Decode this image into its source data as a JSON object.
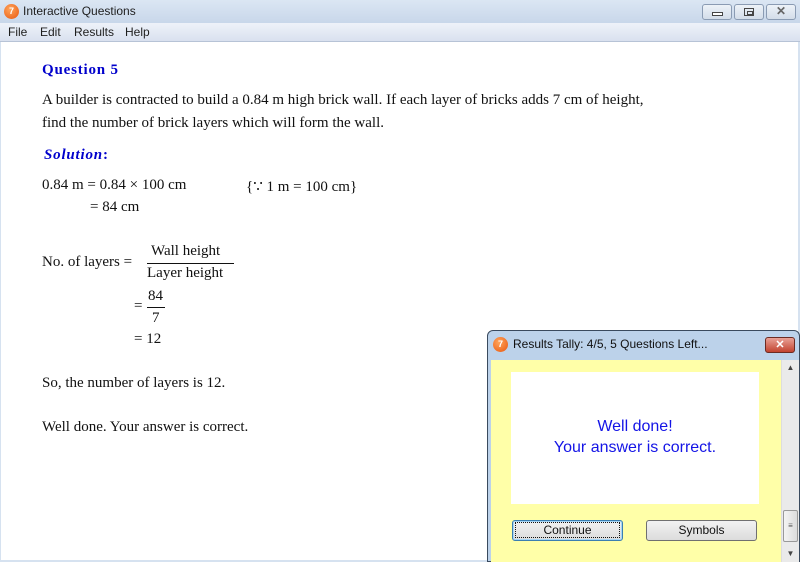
{
  "window": {
    "title": "Interactive Questions",
    "app_icon": "7",
    "controls": {
      "minimize": "minimize-icon",
      "maximize": "restore-icon",
      "close": "✕"
    }
  },
  "menu": [
    "File",
    "Edit",
    "Results",
    "Help"
  ],
  "question": {
    "title": "Question 5",
    "line1": "A builder is contracted to build a 0.84 m high brick wall.  If each layer of bricks adds 7 cm of height,",
    "line2": "find the number of brick layers which will form the wall."
  },
  "solution": {
    "title": "Solution",
    "colon": ":",
    "step1": "0.84 m = 0.84 × 100 cm",
    "step1_note": "{∵ 1 m = 100 cm}",
    "step2": "= 84 cm",
    "layers_label": "No. of layers =",
    "frac1_num": "Wall height",
    "frac1_den": "Layer height",
    "eq2": "=",
    "frac2_num": "84",
    "frac2_den": "7",
    "result": "= 12",
    "conclusion": "So, the number of layers is 12.",
    "feedback": "Well done.  Your answer is correct."
  },
  "dialog": {
    "title": "Results Tally:  4/5, 5 Questions Left...",
    "icon": "7",
    "close": "✕",
    "message_line1": "Well done!",
    "message_line2": "Your answer is correct.",
    "continue_label": "Continue",
    "symbols_label": "Symbols",
    "scroll_up": "▲",
    "scroll_down": "▼",
    "scroll_grip": "≡"
  }
}
